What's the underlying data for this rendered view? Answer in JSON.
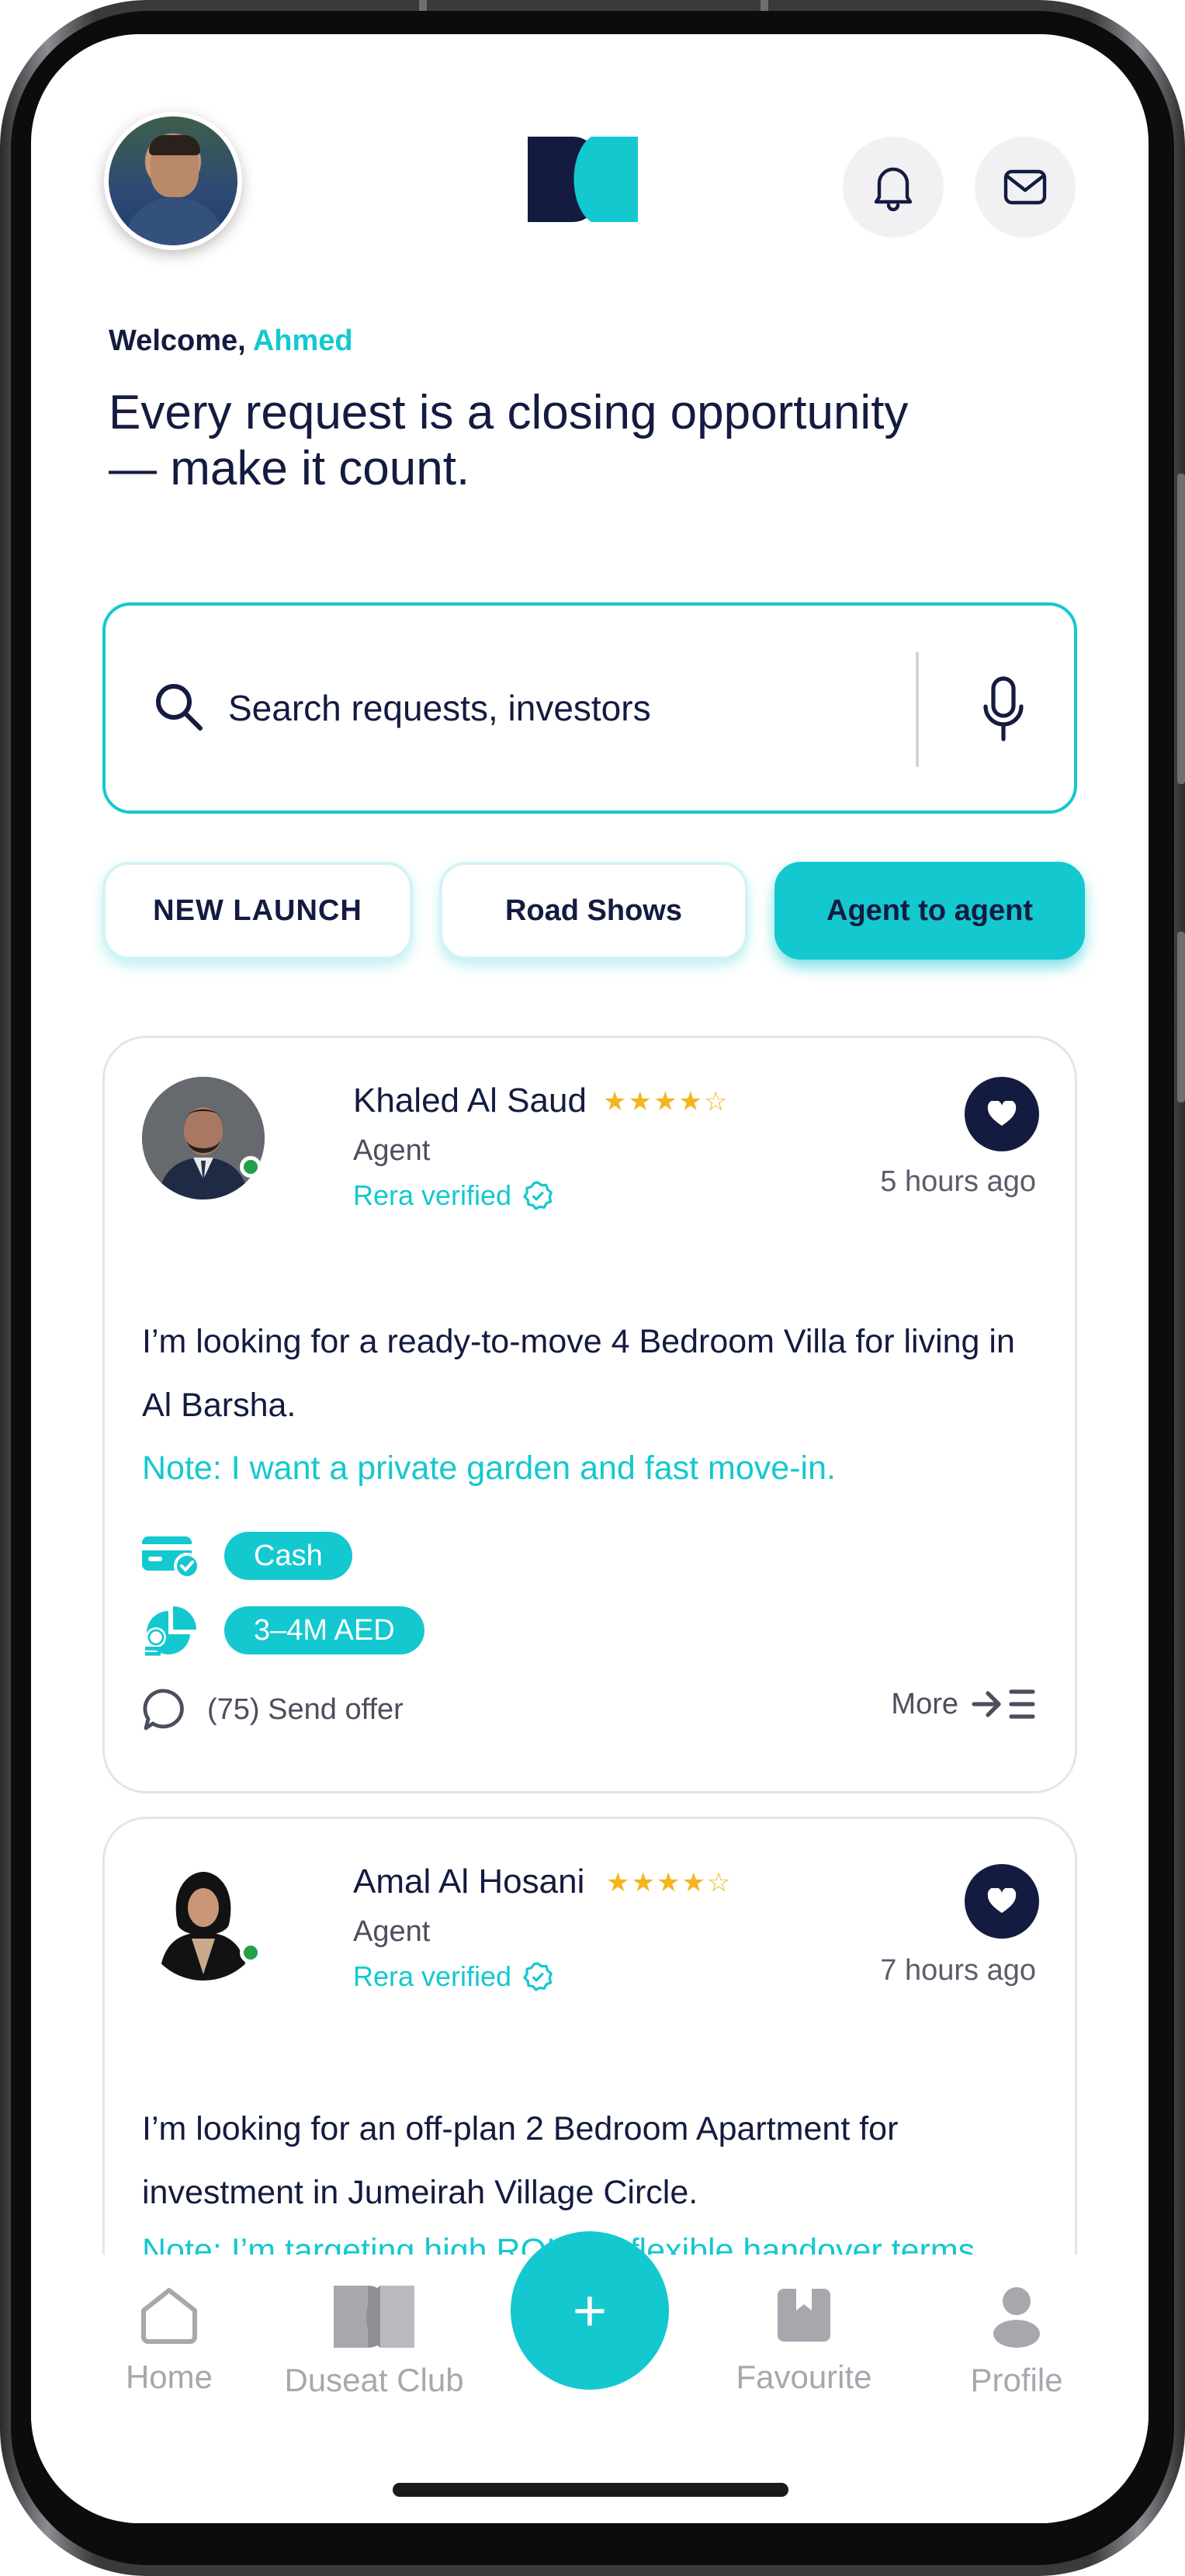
{
  "header": {
    "welcome_prefix": "Welcome,",
    "user_name": "Ahmed",
    "headline": "Every request is a closing opportunity — make it count."
  },
  "search": {
    "placeholder": "Search requests, investors"
  },
  "chips": [
    {
      "label": "NEW LAUNCH"
    },
    {
      "label": "Road Shows"
    },
    {
      "label": "Agent to agent",
      "active": true
    }
  ],
  "requests": [
    {
      "name": "Khaled Al Saud",
      "rating": 4,
      "role": "Agent",
      "verified": "Rera verified",
      "time_ago": "5 hours ago",
      "text": "I’m looking for a ready-to-move 4 Bedroom Villa for living in Al Barsha.",
      "note": "Note: I want a private garden and fast move-in.",
      "payment": "Cash",
      "budget": "3–4M AED",
      "offers": "(75) Send offer",
      "more": "More"
    },
    {
      "name": "Amal Al Hosani",
      "rating": 4,
      "role": "Agent",
      "verified": "Rera verified",
      "time_ago": "7 hours ago",
      "text": "I’m looking for an off-plan 2 Bedroom Apartment for investment in Jumeirah Village Circle.",
      "note": "Note: I’m targeting high ROI and flexible handover terms."
    }
  ],
  "nav": {
    "home": "Home",
    "club": "Duseat Club",
    "add": "+",
    "favourite": "Favourite",
    "profile": "Profile"
  },
  "colors": {
    "accent": "#14c8cf",
    "navy": "#141b40",
    "star": "#f5b51e"
  }
}
